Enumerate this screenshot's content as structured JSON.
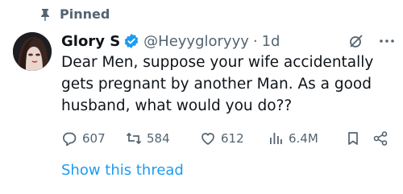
{
  "pinned": {
    "label": "Pinned",
    "icon": "pin-icon"
  },
  "author": {
    "name": "Glory S",
    "handle": "@Heyygloryyy",
    "separator": "·",
    "time": "1d",
    "verified_color": "#1d9bf0"
  },
  "tweet": {
    "text": "Dear Men, suppose your wife accidentally gets pregnant by another Man. As a good husband, what would you do??"
  },
  "actions": {
    "replies": "607",
    "reposts": "584",
    "likes": "612",
    "views": "6.4M"
  },
  "show_thread": "Show this thread",
  "colors": {
    "accent": "#1d9bf0",
    "muted": "#536471",
    "text": "#0f1419"
  }
}
